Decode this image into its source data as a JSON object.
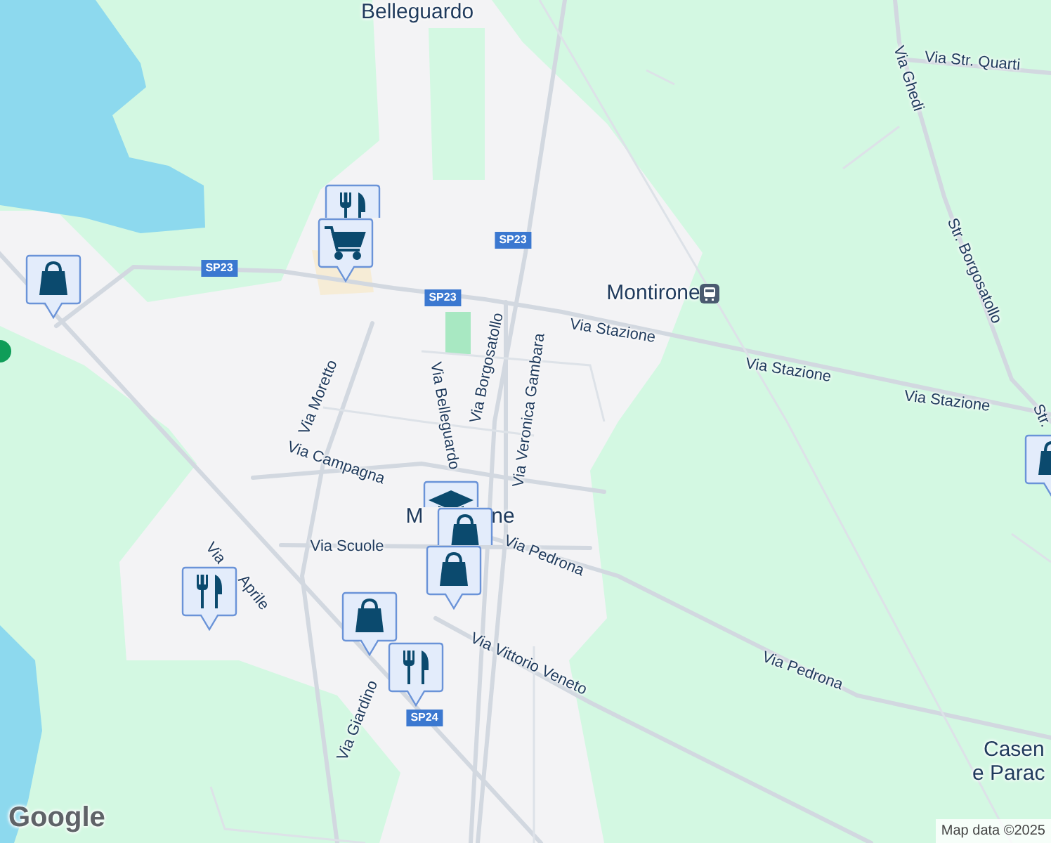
{
  "place_labels": [
    {
      "text": "Belleguardo"
    },
    {
      "text": "Montirone",
      "kind": "station"
    },
    {
      "text": "M"
    },
    {
      "text": "ne"
    },
    {
      "text": "Casen"
    },
    {
      "text": "e Parac"
    }
  ],
  "street_labels": [
    {
      "text": "Via Str. Quarti"
    },
    {
      "text": "Via Ghedi"
    },
    {
      "text": "Str. Borgosatollo"
    },
    {
      "text": "Via Stazione"
    },
    {
      "text": "Via Moretto"
    },
    {
      "text": "Via Belleguardo"
    },
    {
      "text": "Via Borgosatollo"
    },
    {
      "text": "Via Veronica Gambara"
    },
    {
      "text": "Via Stazione"
    },
    {
      "text": "Via Stazione"
    },
    {
      "text": "Str."
    },
    {
      "text": "Via Campagna"
    },
    {
      "text": "Via Scuole"
    },
    {
      "text": "Via Pedrona"
    },
    {
      "text": "Via"
    },
    {
      "text": "Aprile"
    },
    {
      "text": "Via Vittorio Veneto"
    },
    {
      "text": "Via Pedrona"
    },
    {
      "text": "Via Giardino"
    }
  ],
  "road_shields": [
    {
      "text": "SP23"
    },
    {
      "text": "SP23"
    },
    {
      "text": "SP23"
    },
    {
      "text": "SP24"
    }
  ],
  "markers": [
    {
      "kind": "shopping"
    },
    {
      "kind": "dot",
      "color": "#0f9d58"
    },
    {
      "kind": "restaurant"
    },
    {
      "kind": "cart"
    },
    {
      "kind": "school"
    },
    {
      "kind": "shopping"
    },
    {
      "kind": "shopping"
    },
    {
      "kind": "restaurant"
    },
    {
      "kind": "shopping"
    },
    {
      "kind": "restaurant"
    },
    {
      "kind": "shopping"
    }
  ],
  "logo": "Google",
  "attribution": "Map data ©2025"
}
